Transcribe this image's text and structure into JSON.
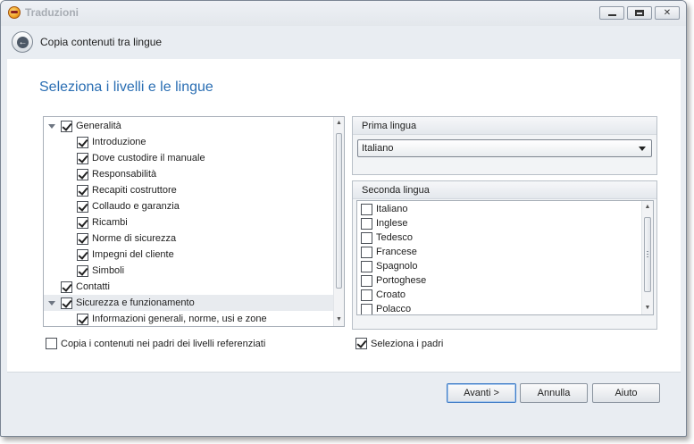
{
  "window": {
    "title": "Traduzioni",
    "minimize_label": "",
    "maximize_label": "",
    "close_label": "✕"
  },
  "header": {
    "back_glyph": "🡐",
    "title": "Copia contenuti tra lingue"
  },
  "page": {
    "title": "Seleziona i livelli e le lingue"
  },
  "tree": {
    "items": [
      {
        "label": "Generalità",
        "level": 0,
        "checked": true,
        "expandable": true
      },
      {
        "label": "Introduzione",
        "level": 1,
        "checked": true
      },
      {
        "label": "Dove custodire il manuale",
        "level": 1,
        "checked": true
      },
      {
        "label": "Responsabilità",
        "level": 1,
        "checked": true
      },
      {
        "label": "Recapiti costruttore",
        "level": 1,
        "checked": true
      },
      {
        "label": "Collaudo e garanzia",
        "level": 1,
        "checked": true
      },
      {
        "label": "Ricambi",
        "level": 1,
        "checked": true
      },
      {
        "label": "Norme di sicurezza",
        "level": 1,
        "checked": true
      },
      {
        "label": "Impegni del cliente",
        "level": 1,
        "checked": true
      },
      {
        "label": "Simboli",
        "level": 1,
        "checked": true
      },
      {
        "label": "Contatti",
        "level": 0,
        "checked": true
      },
      {
        "label": "Sicurezza e funzionamento",
        "level": 0,
        "checked": true,
        "expandable": true,
        "selected": true
      },
      {
        "label": "Informazioni generali, norme, usi e zone",
        "level": 1,
        "checked": true
      }
    ],
    "scroll_up": "▲",
    "scroll_down": "▼"
  },
  "first_language": {
    "label": "Prima lingua",
    "selected": "Italiano"
  },
  "second_language": {
    "label": "Seconda lingua",
    "items": [
      {
        "label": "Italiano",
        "checked": false
      },
      {
        "label": "Inglese",
        "checked": false
      },
      {
        "label": "Tedesco",
        "checked": false
      },
      {
        "label": "Francese",
        "checked": false
      },
      {
        "label": "Spagnolo",
        "checked": false
      },
      {
        "label": "Portoghese",
        "checked": false
      },
      {
        "label": "Croato",
        "checked": false
      },
      {
        "label": "Polacco",
        "checked": false
      }
    ],
    "scroll_up": "▲",
    "scroll_down": "▼"
  },
  "options": {
    "copy_parents_label": "Copia i contenuti nei padri dei livelli referenziati",
    "copy_parents_checked": false,
    "select_parents_label": "Seleziona i padri",
    "select_parents_checked": true
  },
  "footer": {
    "next_label": "Avanti >",
    "cancel_label": "Annulla",
    "help_label": "Aiuto"
  },
  "colors": {
    "accent": "#2a6eb3",
    "window_bg": "#e9edf2"
  }
}
